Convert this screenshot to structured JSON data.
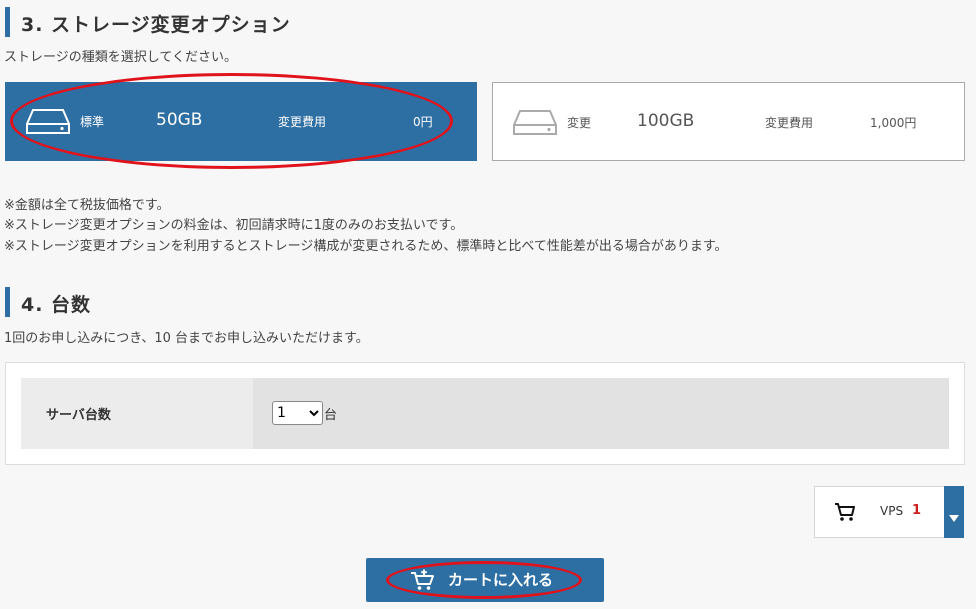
{
  "section3": {
    "title": "3. ストレージ変更オプション",
    "description": "ストレージの種類を選択してください。"
  },
  "storage_options": [
    {
      "name": "標準",
      "size": "50GB",
      "fee_label": "変更費用",
      "fee": "0円",
      "selected": true,
      "icon": "hard-drive-icon"
    },
    {
      "name": "変更",
      "size": "100GB",
      "fee_label": "変更費用",
      "fee": "1,000円",
      "selected": false,
      "icon": "hard-drive-icon"
    }
  ],
  "notes": [
    "※金額は全て税抜価格です。",
    "※ストレージ変更オプションの料金は、初回請求時に1度のみのお支払いです。",
    "※ストレージ変更オプションを利用するとストレージ構成が変更されるため、標準時と比べて性能差が出る場合があります。"
  ],
  "section4": {
    "title": "4. 台数",
    "description": "1回のお申し込みにつき、10 台までお申し込みいただけます。"
  },
  "server_count": {
    "label": "サーバ台数",
    "selected": "1",
    "unit": "台"
  },
  "cart_widget": {
    "icon": "cart-icon",
    "product": "VPS",
    "count": "1",
    "dropdown_icon": "caret-down-icon"
  },
  "add_to_cart": {
    "label": "カートに入れる",
    "icon": "add-to-cart-icon"
  },
  "colors": {
    "primary": "#2d6ea3",
    "highlight_ring": "#e0131c",
    "count_accent": "#cc1f1f"
  }
}
